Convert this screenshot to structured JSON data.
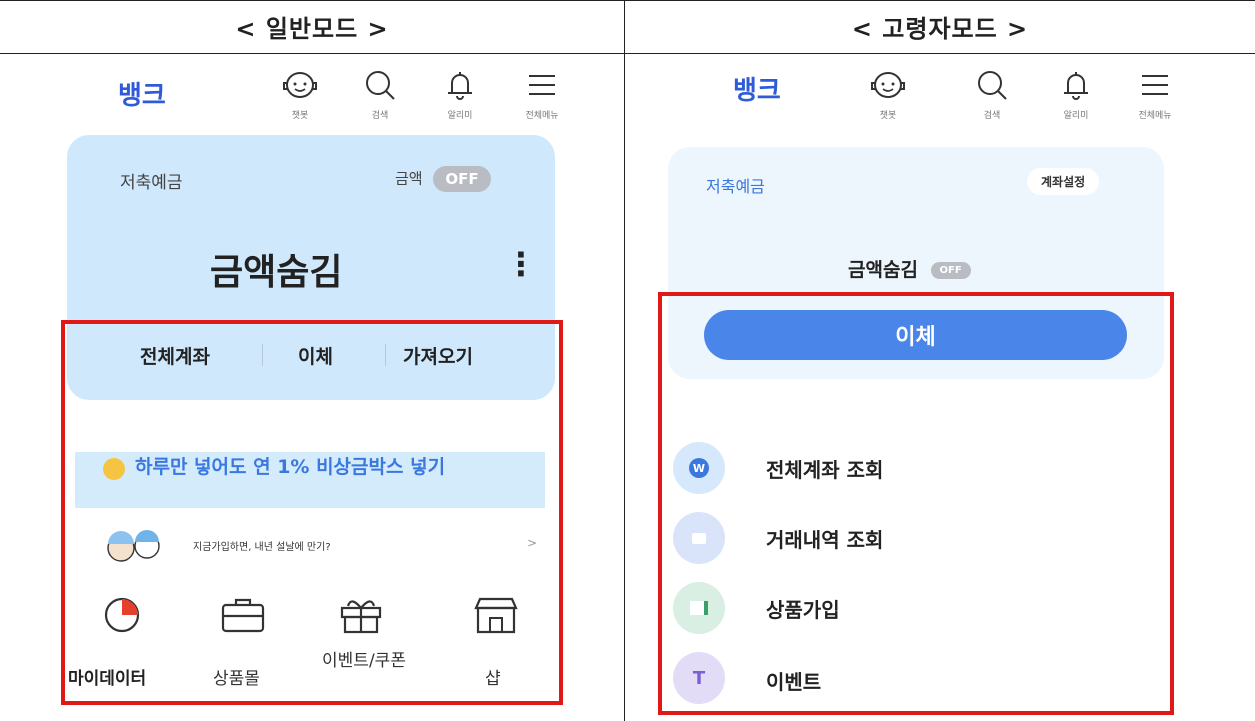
{
  "header": {
    "normal_title": "< 일반모드 >",
    "senior_title": "< 고령자모드 >"
  },
  "normal": {
    "logo": "뱅크",
    "icons": [
      {
        "label": "챗봇",
        "icon": "chatbot-icon"
      },
      {
        "label": "검색",
        "icon": "search-icon"
      },
      {
        "label": "알리미",
        "icon": "bell-icon"
      },
      {
        "label": "전체메뉴",
        "icon": "menu-icon"
      }
    ],
    "account_type": "저축예금",
    "amount_label": "금액",
    "amount_toggle": "OFF",
    "hidden_amount": "금액숨김",
    "more_glyph": "⋮",
    "actions": [
      "전체계좌",
      "이체",
      "가져오기"
    ],
    "promo_banner": "하루만 넣어도 연 1% 비상금박스 넣기",
    "promo_small": "지금가입하면, 내년 설날에 만기?",
    "chevron": ">",
    "quick_menu": [
      {
        "label": "마이데이터",
        "icon": "pie-chart-icon"
      },
      {
        "label": "상품몰",
        "icon": "briefcase-icon"
      },
      {
        "label": "이벤트/쿠폰",
        "icon": "gift-icon"
      },
      {
        "label": "샵",
        "icon": "store-icon"
      }
    ]
  },
  "senior": {
    "logo": "뱅크",
    "icons": [
      {
        "label": "챗봇",
        "icon": "chatbot-icon"
      },
      {
        "label": "검색",
        "icon": "search-icon"
      },
      {
        "label": "알리미",
        "icon": "bell-icon"
      },
      {
        "label": "전체메뉴",
        "icon": "menu-icon"
      }
    ],
    "account_type": "저축예금",
    "account_settings": "계좌설정",
    "hidden_amount": "금액숨김",
    "amount_toggle": "OFF",
    "transfer_button": "이체",
    "menu": [
      {
        "label": "전체계좌 조회",
        "icon": "w-badge-icon",
        "color": "#d6e8fb"
      },
      {
        "label": "거래내역 조회",
        "icon": "document-icon",
        "color": "#d9e4fb"
      },
      {
        "label": "상품가입",
        "icon": "product-icon",
        "color": "#d9efe4"
      },
      {
        "label": "이벤트",
        "icon": "event-icon",
        "color": "#e3dcf7"
      }
    ]
  },
  "colors": {
    "accent": "#2f5bd9",
    "button": "#4a86ea",
    "card": "#cfe8fb",
    "highlight_red": "#e01818"
  }
}
